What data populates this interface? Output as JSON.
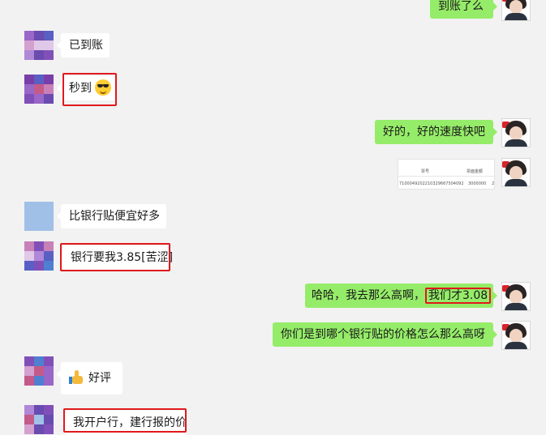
{
  "messages": {
    "m0": "到账了么",
    "m1": "已到账",
    "m2": "秒到",
    "m3": "好的，好的速度快吧",
    "m4": "比银行贴便宜好多",
    "m5": "银行要我3.85[苦涩]",
    "m6a": "哈哈，我去那么高啊，",
    "m6b": "我们才3.08",
    "m7": "你们是到哪个银行贴的价格怎么那么高呀",
    "m8": "好评",
    "m9": "我开户行，建行报的价"
  },
  "image_message": {
    "header_left": "票号",
    "header_mid": "票面金额",
    "row_id": "7100049202210329667504092",
    "row_amount": "3000000",
    "row_more": "2"
  },
  "emojis": {
    "m2": "sunglasses-emoji",
    "m8": "thumbs-up-emoji"
  },
  "colors": {
    "background": "#f2f2f2",
    "bubble_self": "#95ec69",
    "bubble_other": "#ffffff",
    "highlight": "#e0191c"
  }
}
